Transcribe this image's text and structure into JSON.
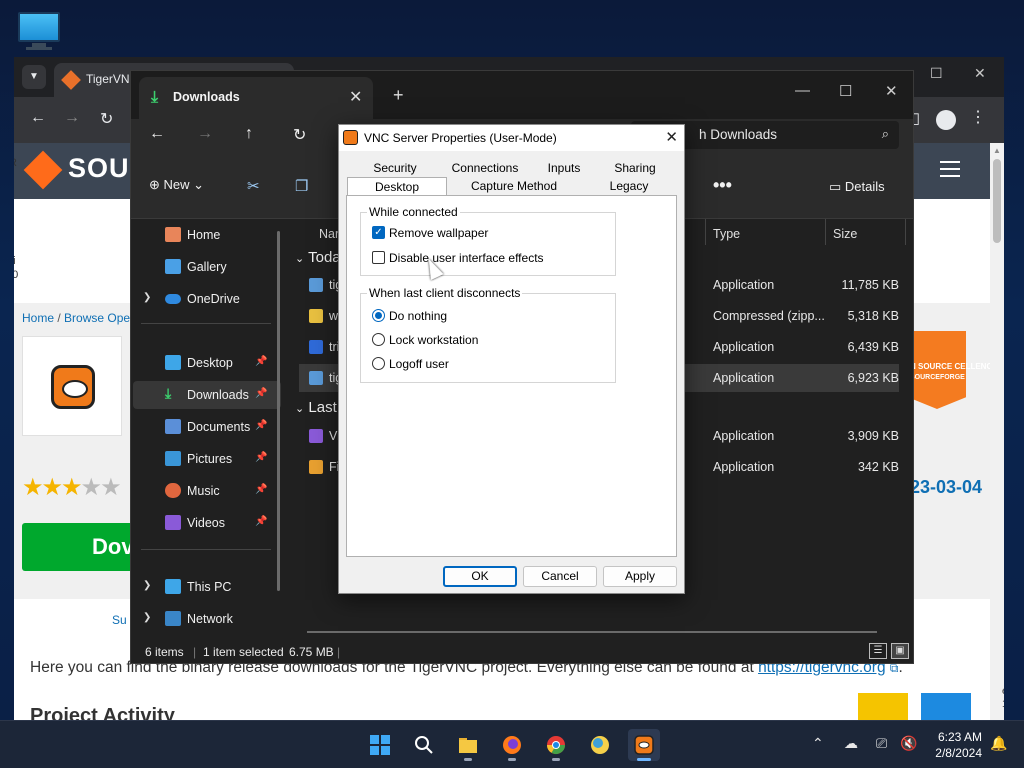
{
  "browser": {
    "tab_title": "TigerVNC",
    "left_text_top": "R",
    "left_text_mid": "Vi",
    "left_text_mid2": "20",
    "logo_text": "SOUR",
    "breadcrumb_home": "Home",
    "breadcrumb_sep": " / ",
    "breadcrumb_browse": "Browse Oper",
    "download_label": "Dov",
    "badge_text": "N SOURCE CELLENCE",
    "badge_sub": "SOURCEFORGE",
    "date_text": "23-03-04",
    "sub_link": "Su",
    "description": "Here you can find the binary release downloads for the TigerVNC project. Everything else can be found at ",
    "description_link": "https://tigervnc.org",
    "description_end": ".",
    "activity_heading": "Project Activity",
    "right_text_1": "ew",
    "right_text_2": "157"
  },
  "explorer": {
    "tab_title": "Downloads",
    "search_placeholder": "h Downloads",
    "new_label": "New",
    "details_label": "Details",
    "sidebar": [
      {
        "label": "Home",
        "pinned": false,
        "expandable": false
      },
      {
        "label": "Gallery",
        "pinned": false,
        "expandable": false
      },
      {
        "label": "OneDrive",
        "pinned": false,
        "expandable": true
      },
      {
        "label": "Desktop",
        "pinned": true,
        "expandable": false
      },
      {
        "label": "Downloads",
        "pinned": true,
        "expandable": false
      },
      {
        "label": "Documents",
        "pinned": true,
        "expandable": false
      },
      {
        "label": "Pictures",
        "pinned": true,
        "expandable": false
      },
      {
        "label": "Music",
        "pinned": true,
        "expandable": false
      },
      {
        "label": "Videos",
        "pinned": true,
        "expandable": false
      },
      {
        "label": "This PC",
        "pinned": false,
        "expandable": true
      },
      {
        "label": "Network",
        "pinned": false,
        "expandable": true
      }
    ],
    "columns": {
      "name": "Nar",
      "type": "Type",
      "size": "Size"
    },
    "groups": [
      {
        "label": "Toda"
      },
      {
        "label": "Last"
      }
    ],
    "files": [
      {
        "name": "tig",
        "type": "Application",
        "size": "11,785 KB"
      },
      {
        "name": "w",
        "type": "Compressed (zipp...",
        "size": "5,318 KB"
      },
      {
        "name": "tri",
        "type": "Application",
        "size": "6,439 KB"
      },
      {
        "name": "tig",
        "type": "Application",
        "size": "6,923 KB"
      },
      {
        "name": "Vi",
        "type": "Application",
        "size": "3,909 KB"
      },
      {
        "name": "Fi",
        "type": "Application",
        "size": "342 KB"
      }
    ],
    "status": {
      "items": "6 items",
      "selected": "1 item selected",
      "size": "6.75 MB"
    }
  },
  "dialog": {
    "title": "VNC Server Properties (User-Mode)",
    "tabs_row1": [
      "Security",
      "Connections",
      "Inputs",
      "Sharing"
    ],
    "tabs_row2": [
      "Desktop",
      "Capture Method",
      "Legacy"
    ],
    "group_connected": "While connected",
    "opt_remove_wallpaper": "Remove wallpaper",
    "opt_disable_effects": "Disable user interface effects",
    "group_disconnect": "When last client disconnects",
    "opt_do_nothing": "Do nothing",
    "opt_lock": "Lock workstation",
    "opt_logoff": "Logoff user",
    "btn_ok": "OK",
    "btn_cancel": "Cancel",
    "btn_apply": "Apply"
  },
  "taskbar": {
    "time": "6:23 AM",
    "date": "2/8/2024"
  },
  "colors": {
    "accent": "#0067c0",
    "explorer_bg": "#202020",
    "sourceforge_orange": "#ff6b1a"
  }
}
